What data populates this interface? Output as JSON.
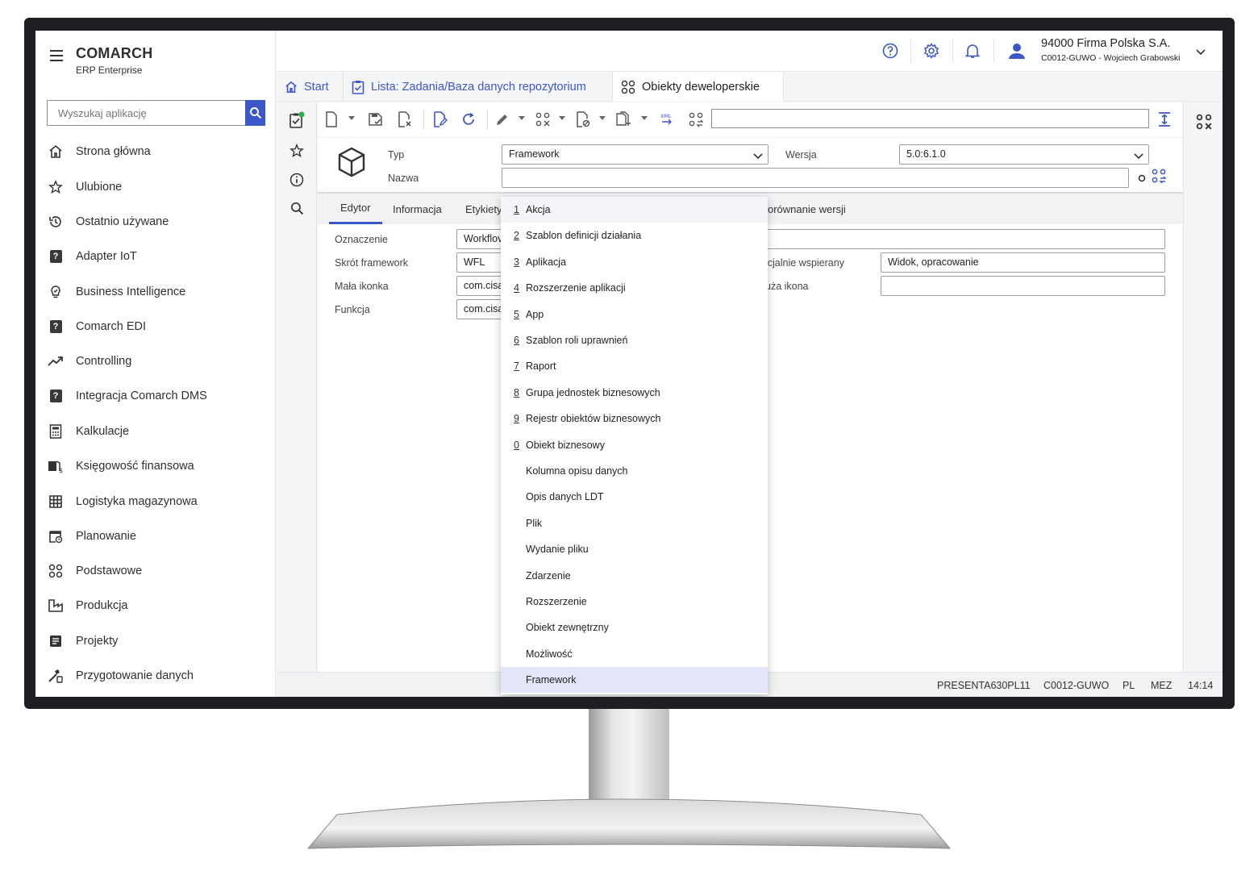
{
  "sidebar": {
    "brand": "COMARCH",
    "brand_sub": "ERP Enterprise",
    "search_placeholder": "Wyszukaj aplikację",
    "items": [
      {
        "label": "Strona główna",
        "icon": "home-icon"
      },
      {
        "label": "Ulubione",
        "icon": "star-icon"
      },
      {
        "label": "Ostatnio używane",
        "icon": "history-icon"
      },
      {
        "label": "Adapter IoT",
        "icon": "question-box-icon"
      },
      {
        "label": "Business Intelligence",
        "icon": "bulb-icon"
      },
      {
        "label": "Comarch EDI",
        "icon": "question-box-icon"
      },
      {
        "label": "Controlling",
        "icon": "trend-icon"
      },
      {
        "label": "Integracja Comarch DMS",
        "icon": "question-box-icon"
      },
      {
        "label": "Kalkulacje",
        "icon": "calculator-icon"
      },
      {
        "label": "Księgowość finansowa",
        "icon": "finance-icon"
      },
      {
        "label": "Logistyka magazynowa",
        "icon": "grid-icon"
      },
      {
        "label": "Planowanie",
        "icon": "calendar-icon"
      },
      {
        "label": "Podstawowe",
        "icon": "circles-icon"
      },
      {
        "label": "Produkcja",
        "icon": "factory-icon"
      },
      {
        "label": "Projekty",
        "icon": "project-icon"
      },
      {
        "label": "Przygotowanie danych",
        "icon": "data-prep-icon"
      }
    ]
  },
  "header": {
    "company": "94000  Firma Polska S.A.",
    "user": "C0012-GUWO - Wojciech Grabowski"
  },
  "tabs": [
    {
      "label": "Start"
    },
    {
      "label": "Lista: Zadania/Baza danych repozytorium"
    },
    {
      "label": "Obiekty deweloperskie"
    }
  ],
  "form": {
    "typ_label": "Typ",
    "typ_value": "Framework",
    "nazwa_label": "Nazwa",
    "wersja_label": "Wersja",
    "wersja_value": "5.0:6.1.0",
    "subtabs": [
      "Edytor",
      "Informacja",
      "Etykiety",
      "orównanie wersji"
    ],
    "oznaczenie_label": "Oznaczenie",
    "oznaczenie_value": "Workflov",
    "skrot_label": "Skrót framework",
    "skrot_value": "WFL",
    "mala_ikonka_label": "Mała ikonka",
    "mala_ikonka_value": "com.cisa",
    "funkcja_label": "Funkcja",
    "funkcja_value": "com.cisa",
    "oficjalnie_label": "icjalnie wspierany",
    "oficjalnie_value": "Widok, opracowanie",
    "duza_ikona_label": "uża ikona",
    "duza_ikona_value": ""
  },
  "dropdown": {
    "items": [
      {
        "num": "1",
        "label": "Akcja"
      },
      {
        "num": "2",
        "label": "Szablon definicji działania"
      },
      {
        "num": "3",
        "label": "Aplikacja"
      },
      {
        "num": "4",
        "label": "Rozszerzenie aplikacji"
      },
      {
        "num": "5",
        "label": "App"
      },
      {
        "num": "6",
        "label": "Szablon roli uprawnień"
      },
      {
        "num": "7",
        "label": "Raport"
      },
      {
        "num": "8",
        "label": "Grupa jednostek biznesowych"
      },
      {
        "num": "9",
        "label": "Rejestr obiektów biznesowych"
      },
      {
        "num": "0",
        "label": "Obiekt biznesowy"
      },
      {
        "num": "",
        "label": "Kolumna opisu danych"
      },
      {
        "num": "",
        "label": "Opis danych LDT"
      },
      {
        "num": "",
        "label": "Plik"
      },
      {
        "num": "",
        "label": "Wydanie pliku"
      },
      {
        "num": "",
        "label": "Zdarzenie"
      },
      {
        "num": "",
        "label": "Rozszerzenie"
      },
      {
        "num": "",
        "label": "Obiekt zewnętrzny"
      },
      {
        "num": "",
        "label": "Możliwość"
      },
      {
        "num": "",
        "label": "Framework"
      }
    ],
    "selected": "Framework"
  },
  "statusbar": {
    "system": "PRESENTA630PL11",
    "user_code": "C0012-GUWO",
    "language": "PL",
    "timezone": "MEZ",
    "time": "14:14"
  },
  "colors": {
    "accent": "#3b57c8",
    "selected_item": "#e3e6f8",
    "status_dot": "#2eaa4a"
  }
}
